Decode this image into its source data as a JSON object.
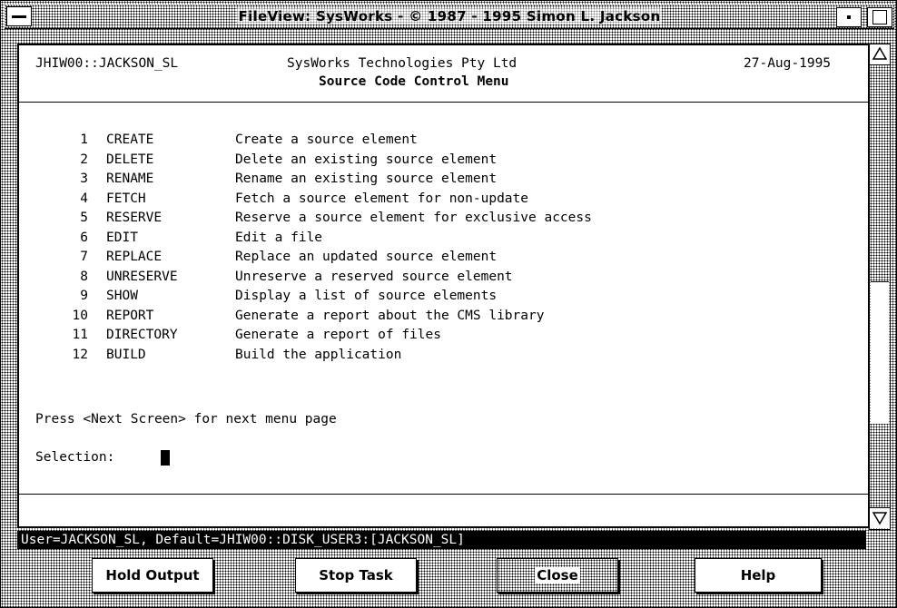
{
  "window": {
    "title": "FileView: SysWorks - © 1987 - 1995 Simon L. Jackson"
  },
  "header": {
    "node_user": "JHIW00::JACKSON_SL",
    "company": "SysWorks Technologies Pty Ltd",
    "date": "27-Aug-1995",
    "menu_title": "Source Code Control Menu"
  },
  "menu": {
    "items": [
      {
        "num": "1",
        "command": "CREATE",
        "description": "Create a source element"
      },
      {
        "num": "2",
        "command": "DELETE",
        "description": "Delete an existing source element"
      },
      {
        "num": "3",
        "command": "RENAME",
        "description": "Rename an existing source element"
      },
      {
        "num": "4",
        "command": "FETCH",
        "description": "Fetch a source element for non-update"
      },
      {
        "num": "5",
        "command": "RESERVE",
        "description": "Reserve a source element for exclusive access"
      },
      {
        "num": "6",
        "command": "EDIT",
        "description": "Edit a file"
      },
      {
        "num": "7",
        "command": "REPLACE",
        "description": "Replace an updated source element"
      },
      {
        "num": "8",
        "command": "UNRESERVE",
        "description": "Unreserve a reserved source element"
      },
      {
        "num": "9",
        "command": "SHOW",
        "description": "Display a list of source elements"
      },
      {
        "num": "10",
        "command": "REPORT",
        "description": "Generate a report about the CMS library"
      },
      {
        "num": "11",
        "command": "DIRECTORY",
        "description": "Generate a report of files"
      },
      {
        "num": "12",
        "command": "BUILD",
        "description": "Build the application"
      }
    ]
  },
  "prompt": {
    "next_hint": "Press <Next Screen> for next menu page",
    "selection_label": "Selection:"
  },
  "status": {
    "text": "User=JACKSON_SL, Default=JHIW00::DISK_USER3:[JACKSON_SL]"
  },
  "buttons": {
    "hold": "Hold Output",
    "stop": "Stop Task",
    "close": "Close",
    "help": "Help"
  },
  "icons": {
    "system_menu": "system-menu-icon",
    "minimize": "minimize-icon",
    "maximize": "maximize-icon",
    "scroll_up": "scroll-up-arrow-icon",
    "scroll_down": "scroll-down-arrow-icon"
  },
  "scrollbar": {
    "position_fraction": 0.72
  }
}
